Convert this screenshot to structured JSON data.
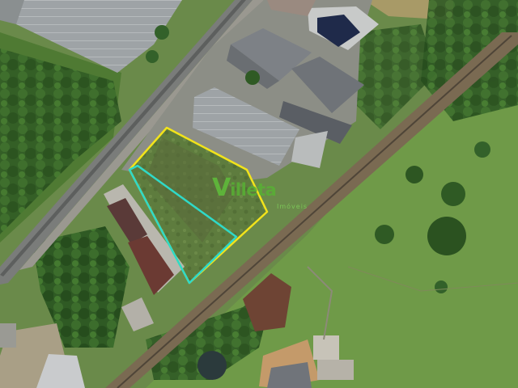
{
  "map": {
    "view": "satellite",
    "watermark": {
      "initial": "V",
      "rest": "illeta",
      "subtitle": "Imóveis",
      "color": "#5fbf3a"
    },
    "outlines": {
      "lot_boundary_color": "#f2e31b",
      "inner_area_color": "#2fd9c8"
    }
  }
}
